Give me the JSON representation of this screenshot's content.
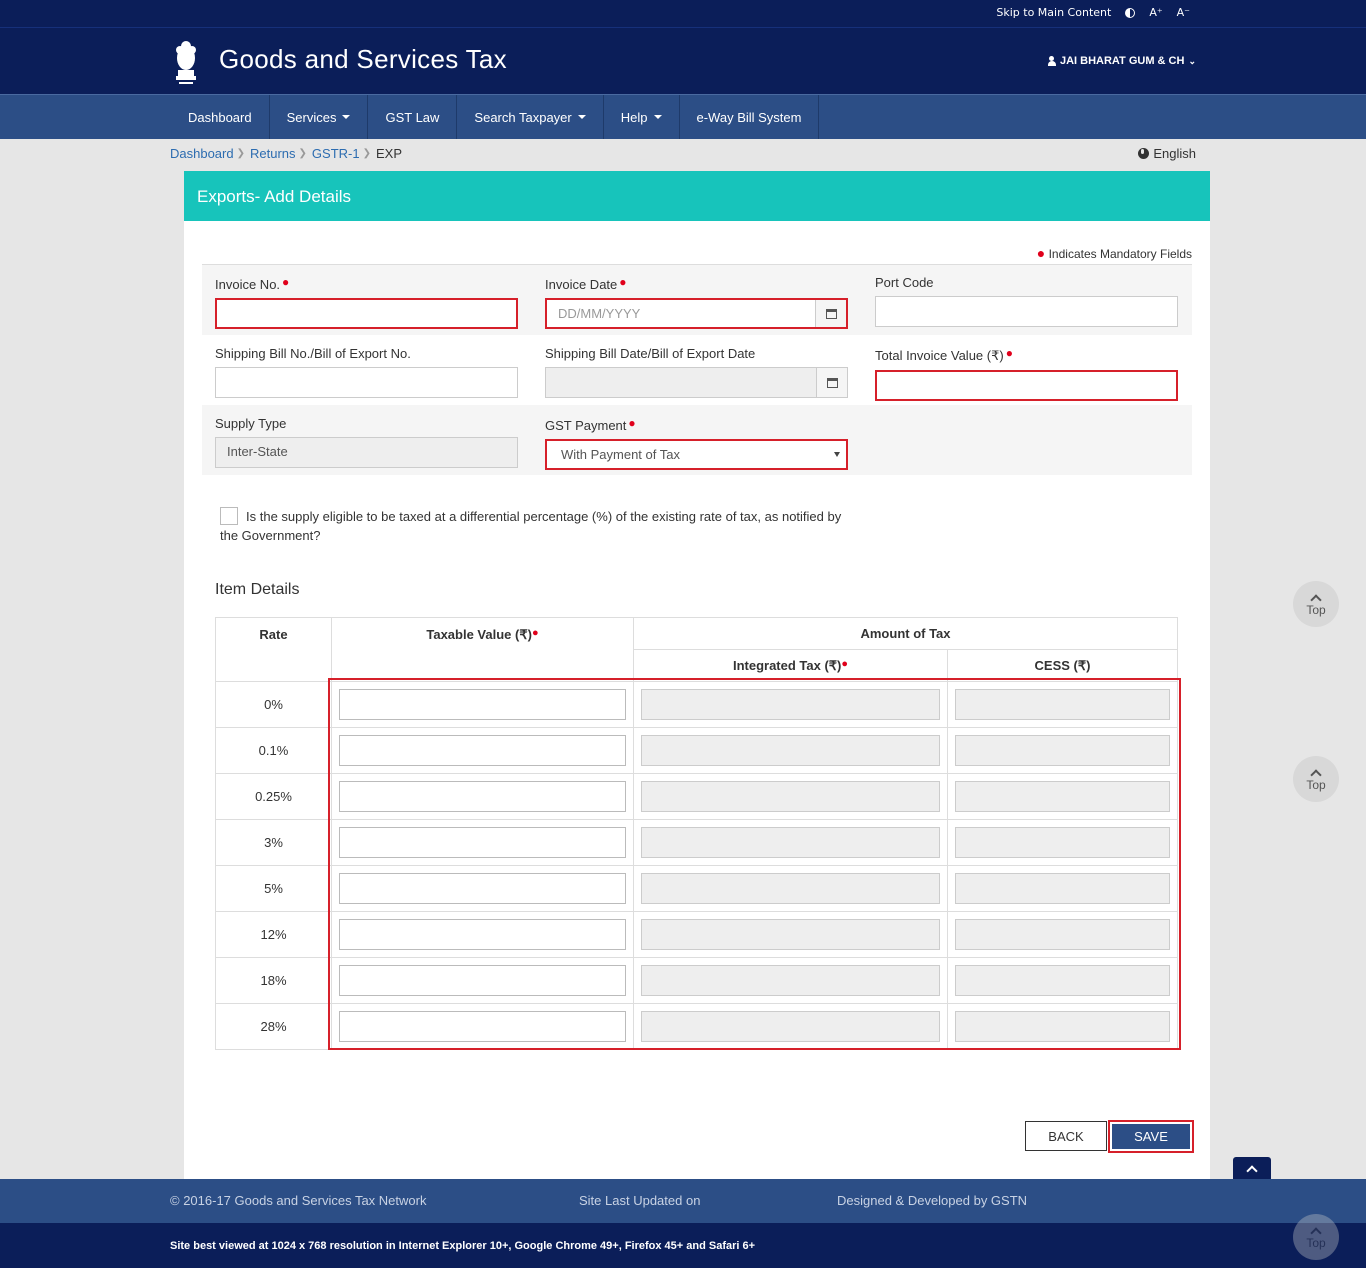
{
  "util": {
    "skip": "Skip to Main Content",
    "font_up": "A⁺",
    "font_down": "A⁻"
  },
  "header": {
    "title": "Goods and Services Tax",
    "user": "JAI BHARAT GUM & CH"
  },
  "nav": [
    {
      "label": "Dashboard",
      "dropdown": false
    },
    {
      "label": "Services",
      "dropdown": true
    },
    {
      "label": "GST Law",
      "dropdown": false
    },
    {
      "label": "Search Taxpayer",
      "dropdown": true
    },
    {
      "label": "Help",
      "dropdown": true
    },
    {
      "label": "e-Way Bill System",
      "dropdown": false
    }
  ],
  "breadcrumb": {
    "items": [
      "Dashboard",
      "Returns",
      "GSTR-1"
    ],
    "current": "EXP",
    "language": "English"
  },
  "form": {
    "title": "Exports- Add Details",
    "mandatory_note": "Indicates Mandatory Fields",
    "invoice_no": {
      "label": "Invoice No.",
      "value": ""
    },
    "invoice_date": {
      "label": "Invoice Date",
      "placeholder": "DD/MM/YYYY"
    },
    "port_code": {
      "label": "Port Code",
      "value": ""
    },
    "shipping_bill_no": {
      "label": "Shipping Bill No./Bill of Export No.",
      "value": ""
    },
    "shipping_bill_date": {
      "label": "Shipping Bill Date/Bill of Export Date",
      "value": ""
    },
    "total_invoice_value": {
      "label": "Total Invoice Value (₹)",
      "value": ""
    },
    "supply_type": {
      "label": "Supply Type",
      "value": "Inter-State"
    },
    "gst_payment": {
      "label": "GST Payment",
      "value": "With Payment of Tax"
    },
    "differential_text": "Is the supply eligible to be taxed at a differential percentage (%) of the existing rate of tax, as notified by the Government?"
  },
  "items": {
    "title": "Item Details",
    "headers": {
      "rate": "Rate",
      "taxable": "Taxable Value (₹)",
      "amount": "Amount of Tax",
      "igst": "Integrated Tax (₹)",
      "cess": "CESS (₹)"
    },
    "rates": [
      "0%",
      "0.1%",
      "0.25%",
      "3%",
      "5%",
      "12%",
      "18%",
      "28%"
    ]
  },
  "buttons": {
    "back": "BACK",
    "save": "SAVE",
    "top": "Top"
  },
  "footer": {
    "copyright": "© 2016-17 Goods and Services Tax Network",
    "updated": "Site Last Updated on",
    "designed": "Designed & Developed by GSTN",
    "best_viewed": "Site best viewed at 1024 x 768 resolution in Internet Explorer 10+, Google Chrome 49+, Firefox 45+ and Safari 6+"
  },
  "colors": {
    "header": "#0b1e59",
    "nav": "#2c4e86",
    "card_head": "#17c4bb",
    "highlight": "#d6202a"
  }
}
